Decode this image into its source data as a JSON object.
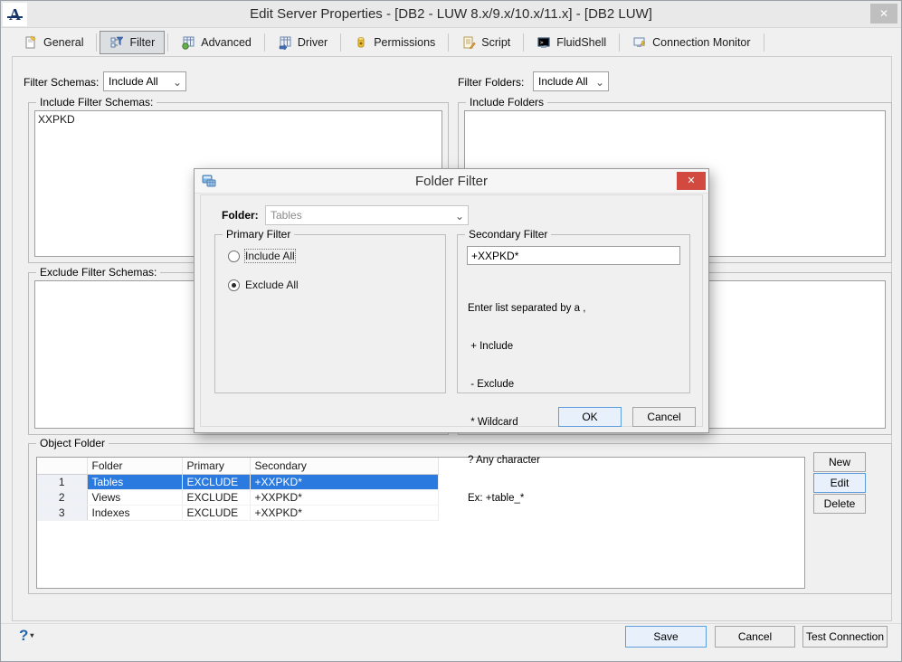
{
  "window": {
    "title": "Edit Server Properties - [DB2 - LUW 8.x/9.x/10.x/11.x] - [DB2 LUW]",
    "close_glyph": "✕"
  },
  "tabs": [
    {
      "label": "General"
    },
    {
      "label": "Filter",
      "selected": true
    },
    {
      "label": "Advanced"
    },
    {
      "label": "Driver"
    },
    {
      "label": "Permissions"
    },
    {
      "label": "Script"
    },
    {
      "label": "FluidShell"
    },
    {
      "label": "Connection Monitor"
    }
  ],
  "filter_tab": {
    "filter_schemas_label": "Filter Schemas:",
    "filter_schemas_value": "Include All",
    "filter_folders_label": "Filter Folders:",
    "filter_folders_value": "Include All",
    "include_filter_schemas_label": "Include Filter Schemas:",
    "include_filter_schemas_content": "XXPKD",
    "exclude_filter_schemas_label": "Exclude Filter Schemas:",
    "include_folders_label": "Include Folders",
    "object_folder": {
      "label": "Object Folder",
      "columns": [
        "",
        "Folder",
        "Primary",
        "Secondary"
      ],
      "rows": [
        {
          "num": "1",
          "folder": "Tables",
          "primary": "EXCLUDE",
          "secondary": "+XXPKD*",
          "selected": true
        },
        {
          "num": "2",
          "folder": "Views",
          "primary": "EXCLUDE",
          "secondary": "+XXPKD*"
        },
        {
          "num": "3",
          "folder": "Indexes",
          "primary": "EXCLUDE",
          "secondary": "+XXPKD*"
        }
      ],
      "new_label": "New",
      "edit_label": "Edit",
      "delete_label": "Delete"
    }
  },
  "dialog": {
    "title": "Folder Filter",
    "close_glyph": "✕",
    "folder_label": "Folder:",
    "folder_value": "Tables",
    "primary_filter": {
      "label": "Primary Filter",
      "include_all_label": "Include All",
      "exclude_all_label": "Exclude All",
      "selected_option": "Exclude All"
    },
    "secondary_filter": {
      "label": "Secondary Filter",
      "value": "+XXPKD*",
      "help_lines": [
        "Enter list separated by a ,",
        " + Include",
        " - Exclude",
        " * Wildcard",
        "? Any character",
        "Ex: +table_*"
      ]
    },
    "ok_label": "OK",
    "cancel_label": "Cancel"
  },
  "footer": {
    "help_glyph": "?",
    "caret_glyph": "▾",
    "save_label": "Save",
    "cancel_label": "Cancel",
    "test_connection_label": "Test Connection"
  },
  "icons": {
    "chevron_down": "⌄"
  },
  "colors": {
    "selection_blue": "#2a7ae0",
    "dialog_close_red": "#d2493f",
    "focus_button_border": "#5e9ede",
    "help_blue": "#2566a8"
  }
}
